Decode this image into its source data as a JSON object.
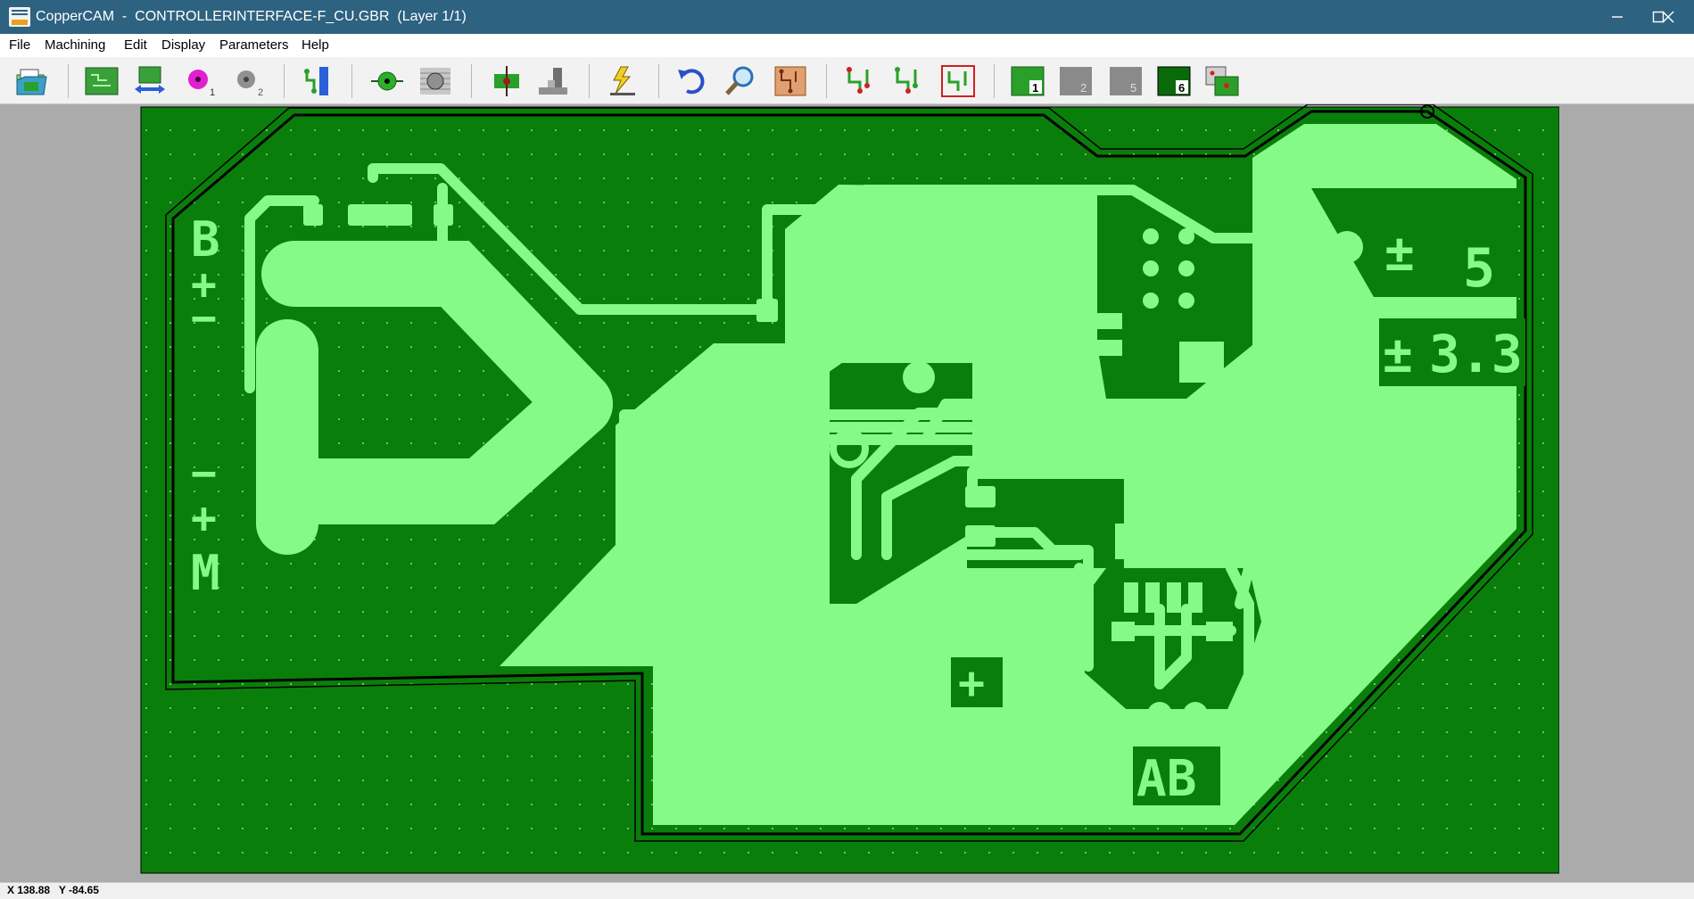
{
  "window": {
    "app_name": "CopperCAM",
    "title": "CopperCAM  -  CONTROLLERINTERFACE-F_CU.GBR  (Layer 1/1)",
    "logo_icon": "coppercam-logo-icon",
    "minimize_icon": "minimize-icon",
    "maximize_icon": "maximize-icon",
    "close_icon": "close-icon"
  },
  "menu": {
    "items": [
      "File",
      "Machining",
      "Edit",
      "Display",
      "Parameters",
      "Help"
    ]
  },
  "toolbar": {
    "tools": [
      {
        "name": "open-file",
        "icon": "open-folder-icon"
      },
      {
        "name": "board-view",
        "icon": "pcb-board-icon"
      },
      {
        "name": "mirror-board",
        "icon": "mirror-arrows-icon"
      },
      {
        "name": "drill-tool-1",
        "icon": "drill-magenta-icon",
        "label": "1"
      },
      {
        "name": "drill-tool-2",
        "icon": "drill-gray-icon",
        "label": "2"
      },
      {
        "name": "tracks-layer",
        "icon": "tracks-blue-icon"
      },
      {
        "name": "pad-select",
        "icon": "pad-green-icon"
      },
      {
        "name": "pad-hatch",
        "icon": "pad-hatch-icon"
      },
      {
        "name": "drill-center",
        "icon": "board-center-icon"
      },
      {
        "name": "mill-tool",
        "icon": "milling-machine-icon"
      },
      {
        "name": "engrave",
        "icon": "engrave-spark-icon"
      },
      {
        "name": "undo",
        "icon": "undo-icon"
      },
      {
        "name": "zoom",
        "icon": "magnifier-icon"
      },
      {
        "name": "copper-board",
        "icon": "copper-board-icon"
      },
      {
        "name": "contour-1",
        "icon": "contour-red-icon"
      },
      {
        "name": "contour-2",
        "icon": "contour-green-icon"
      },
      {
        "name": "contour-3",
        "icon": "contour-box-icon"
      },
      {
        "name": "layer-1",
        "icon": "layer-icon",
        "label": "1"
      },
      {
        "name": "layer-2",
        "icon": "layer-gray-icon",
        "label": "2"
      },
      {
        "name": "layer-5",
        "icon": "layer-gray-icon",
        "label": "5"
      },
      {
        "name": "layer-6",
        "icon": "layer-dark-icon",
        "label": "6"
      },
      {
        "name": "layer-multi",
        "icon": "layer-multi-icon"
      }
    ]
  },
  "board": {
    "silkscreen": {
      "b_plus_minus": [
        "B",
        "+",
        "−"
      ],
      "m_minus_plus": [
        "−",
        "+",
        "M"
      ],
      "plus_bottom": "+",
      "ab_label": "AB",
      "pm_label": "±",
      "five_label": "5",
      "pm_label2": "±",
      "v33_label": "3.3"
    },
    "colors": {
      "background": "#0a7e0a",
      "copper": "#86fa86",
      "outline": "#000000"
    }
  },
  "status": {
    "coords": "X 138.88   Y -84.65"
  }
}
